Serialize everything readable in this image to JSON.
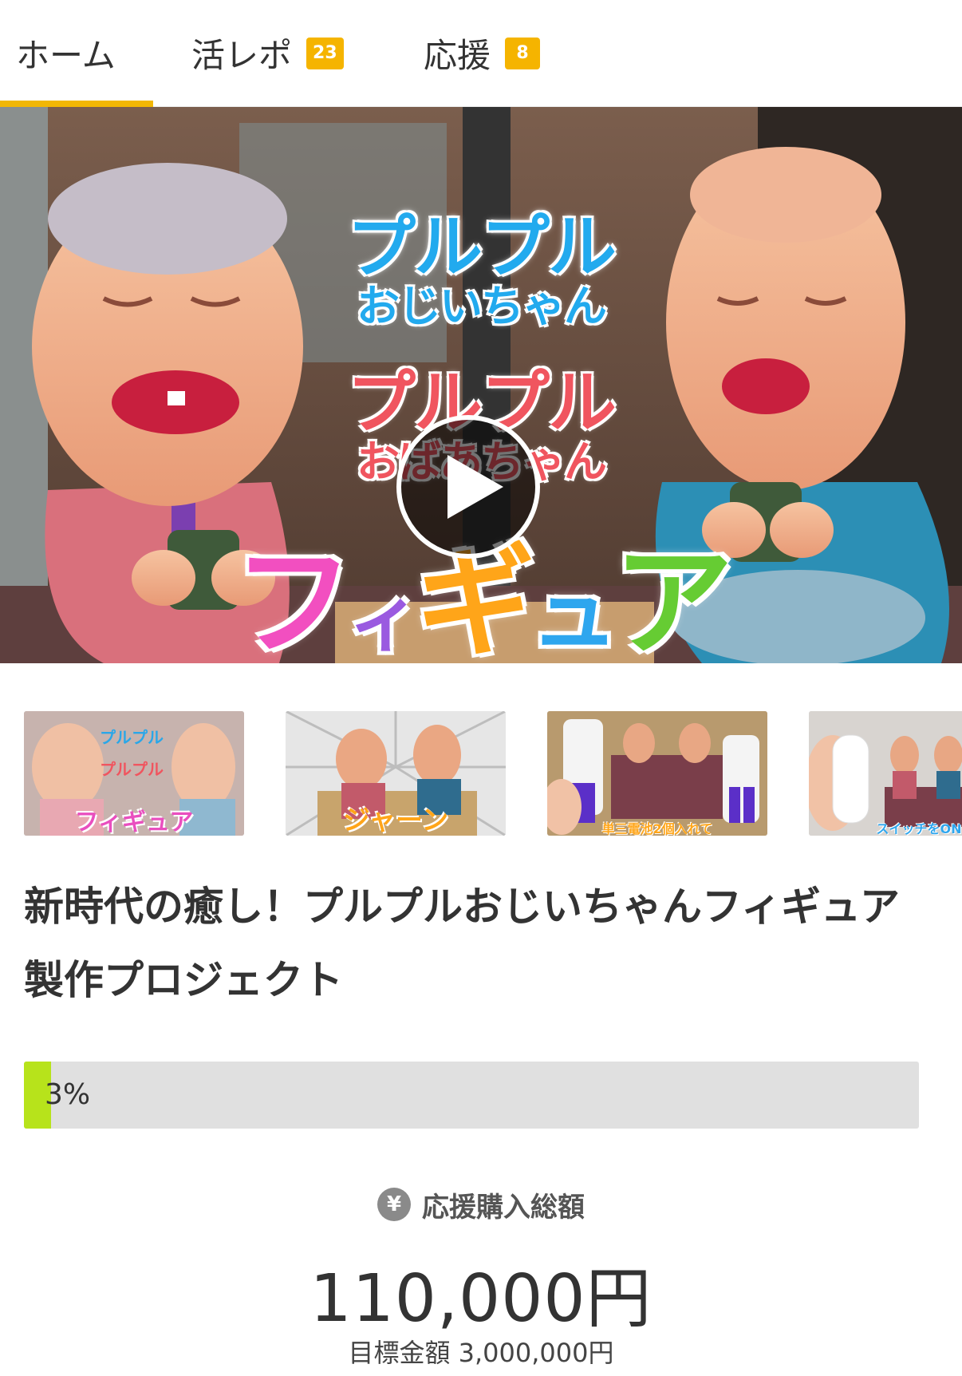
{
  "tabs": [
    {
      "label": "ホーム",
      "badge": null,
      "active": true
    },
    {
      "label": "活レポ",
      "badge": "23"
    },
    {
      "label": "応援",
      "badge": "8"
    }
  ],
  "colors": {
    "accent": "#f2b705",
    "badge": "#f5b400",
    "progress_fill": "#b7e31b",
    "progress_track": "#e0e0e0"
  },
  "hero": {
    "line1": "プルプル",
    "line2": "おじいちゃん",
    "line3": "プルプル",
    "line4": "おばあちゃん",
    "line5_chars": [
      "フ",
      "ィ",
      "ギ",
      "ュ",
      "ア"
    ],
    "play_icon": "play-icon"
  },
  "thumbnails": [
    {
      "caption": "フィギュア"
    },
    {
      "caption": "ジャーン"
    },
    {
      "caption": "単三電池2個入れて"
    },
    {
      "caption": "スイッチをON"
    }
  ],
  "project": {
    "title": "新時代の癒し！プルプルおじいちゃんフィギュア製作プロジェクト"
  },
  "progress": {
    "percent": 3,
    "label": "3%"
  },
  "funding": {
    "currency_icon": "¥",
    "label": "応援購入総額",
    "amount": "110,000円",
    "goal": "目標金額 3,000,000円"
  }
}
